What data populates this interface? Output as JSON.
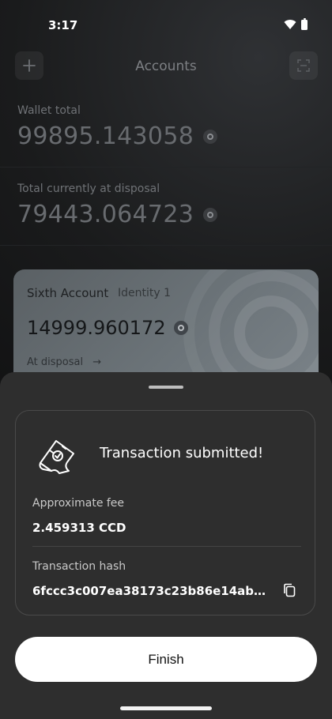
{
  "status_bar": {
    "time": "3:17"
  },
  "header": {
    "title": "Accounts",
    "plus_icon": "plus-icon",
    "scan_icon": "scan-icon"
  },
  "wallet": {
    "total_label": "Wallet total",
    "total_value": "99895.143058",
    "disposal_label": "Total currently at disposal",
    "disposal_value": "79443.064723"
  },
  "account_card": {
    "name": "Sixth Account",
    "identity": "Identity 1",
    "balance": "14999.960172",
    "at_disposal": "At disposal",
    "arrow": "→"
  },
  "sheet": {
    "title": "Transaction submitted!",
    "fee_label": "Approximate fee",
    "fee_value": "2.459313 CCD",
    "hash_label": "Transaction hash",
    "hash_value": "6fccc3c007ea38173c23b86e14ab5b...",
    "finish_label": "Finish"
  },
  "colors": {
    "background": "#0f0f10",
    "sheet": "#2e2e2e",
    "card": "#6b7378",
    "button": "#ffffff"
  }
}
